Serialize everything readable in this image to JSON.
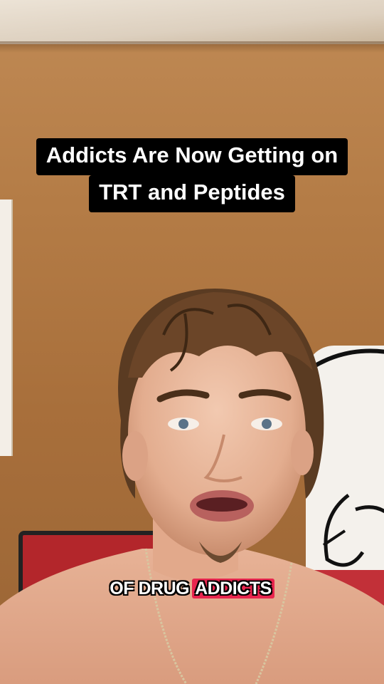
{
  "overlay": {
    "title_line_1": "Addicts Are Now Getting on",
    "title_line_2": "TRT and Peptides"
  },
  "caption": {
    "word_1": "OF DRUG",
    "word_highlight": "ADDICTS",
    "highlight_color": "#e8254e"
  },
  "scene": {
    "wall_color": "#b07a45",
    "ceiling_color": "#e6dccd"
  }
}
